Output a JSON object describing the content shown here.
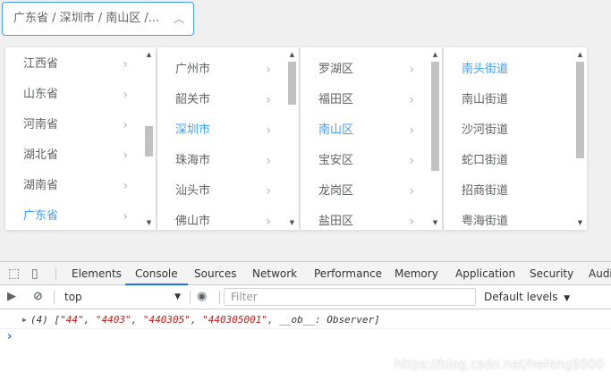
{
  "cascader": {
    "value_text": "广东省 / 深圳市 / 南山区 /...",
    "arrow_icon": "chevron-up-icon",
    "columns": [
      {
        "items": [
          {
            "label": "江西省",
            "active": false
          },
          {
            "label": "山东省",
            "active": false
          },
          {
            "label": "河南省",
            "active": false
          },
          {
            "label": "湖北省",
            "active": false
          },
          {
            "label": "湖南省",
            "active": false
          },
          {
            "label": "广东省",
            "active": true
          }
        ]
      },
      {
        "items": [
          {
            "label": "广州市",
            "active": false
          },
          {
            "label": "韶关市",
            "active": false
          },
          {
            "label": "深圳市",
            "active": true
          },
          {
            "label": "珠海市",
            "active": false
          },
          {
            "label": "汕头市",
            "active": false
          },
          {
            "label": "佛山市",
            "active": false
          }
        ]
      },
      {
        "items": [
          {
            "label": "罗湖区",
            "active": false
          },
          {
            "label": "福田区",
            "active": false
          },
          {
            "label": "南山区",
            "active": true
          },
          {
            "label": "宝安区",
            "active": false
          },
          {
            "label": "龙岗区",
            "active": false
          },
          {
            "label": "盐田区",
            "active": false
          }
        ]
      },
      {
        "items": [
          {
            "label": "南头街道",
            "active": true
          },
          {
            "label": "南山街道",
            "active": false
          },
          {
            "label": "沙河街道",
            "active": false
          },
          {
            "label": "蛇口街道",
            "active": false
          },
          {
            "label": "招商街道",
            "active": false
          },
          {
            "label": "粤海街道",
            "active": false
          }
        ]
      }
    ],
    "active_color": "#409eff"
  },
  "devtools": {
    "tabs": [
      "Elements",
      "Console",
      "Sources",
      "Network",
      "Performance",
      "Memory",
      "Application",
      "Security",
      "Audi"
    ],
    "active_tab": "Console",
    "context": "top",
    "filter_placeholder": "Filter",
    "levels": "Default levels",
    "console_log": {
      "prefix": "(4) [",
      "values": [
        "\"44\"",
        "\"4403\"",
        "\"440305\"",
        "\"440305001\""
      ],
      "suffix": ", __ob__: Observer]"
    },
    "prompt": "›"
  },
  "watermark": "https://blog.csdn.net/hefeng6500"
}
